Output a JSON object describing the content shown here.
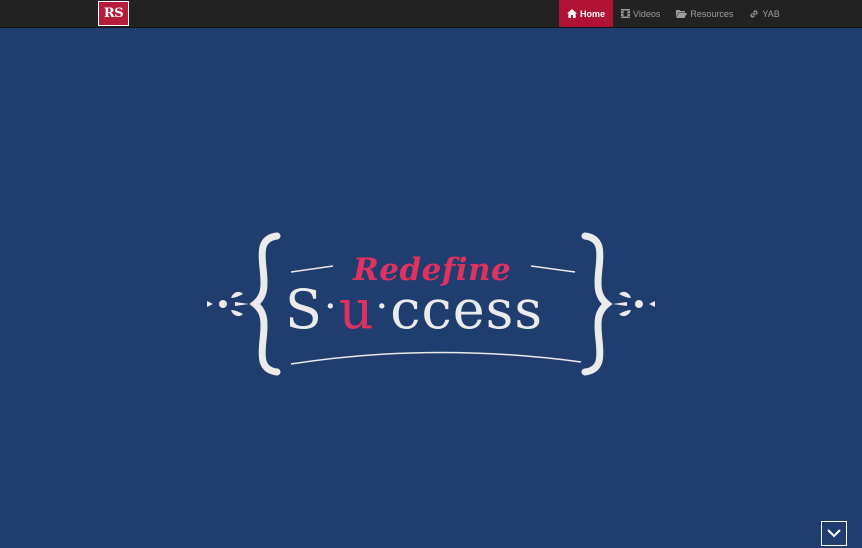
{
  "brand": {
    "logo_text": "RS"
  },
  "nav": {
    "items": [
      {
        "label": "Home",
        "icon": "home-icon",
        "active": true
      },
      {
        "label": "Videos",
        "icon": "film-icon",
        "active": false
      },
      {
        "label": "Resources",
        "icon": "folder-open-icon",
        "active": false
      },
      {
        "label": "YAB",
        "icon": "link-icon",
        "active": false
      }
    ]
  },
  "hero": {
    "tagline": "Redefine",
    "word_s": "S",
    "word_dot": "·",
    "word_u": "u",
    "word_rest": "ccess",
    "scroll_icon": "chevron-down-icon"
  },
  "colors": {
    "navbar_bg": "#222222",
    "active_nav_bg": "#b01233",
    "hero_bg": "#1f3d6e",
    "accent": "#e0325e",
    "logo_text": "#ebebeb"
  }
}
